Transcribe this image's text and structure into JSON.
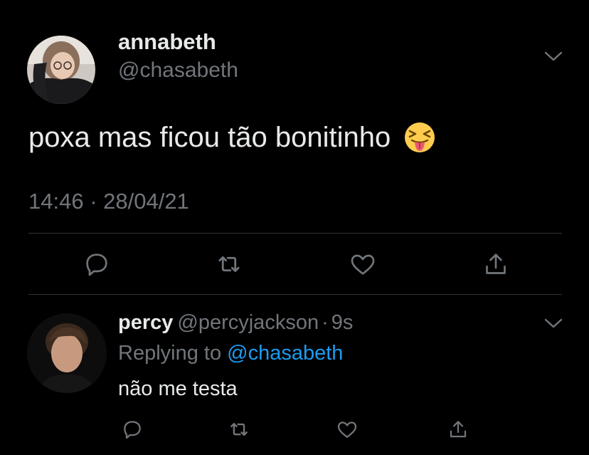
{
  "colors": {
    "background": "#000000",
    "primary_text": "#e7e9ea",
    "secondary_text": "#71767b",
    "link": "#1d9bf0",
    "divider": "#2f3336"
  },
  "main_tweet": {
    "display_name": "annabeth",
    "handle": "@chasabeth",
    "text": "poxa mas ficou tão bonitinho",
    "emoji": "squinting-face-with-tongue",
    "timestamp": "14:46 · 28/04/21",
    "icons": {
      "menu": "chevron-down-icon",
      "reply": "reply-icon",
      "retweet": "retweet-icon",
      "like": "heart-icon",
      "share": "share-icon"
    }
  },
  "reply_tweet": {
    "display_name": "percy",
    "handle": "@percyjackson",
    "separator": "·",
    "time_ago": "9s",
    "replying_label": "Replying to",
    "replying_to": "@chasabeth",
    "text": "não me testa",
    "icons": {
      "menu": "chevron-down-icon",
      "reply": "reply-icon",
      "retweet": "retweet-icon",
      "like": "heart-icon",
      "share": "share-icon"
    }
  }
}
